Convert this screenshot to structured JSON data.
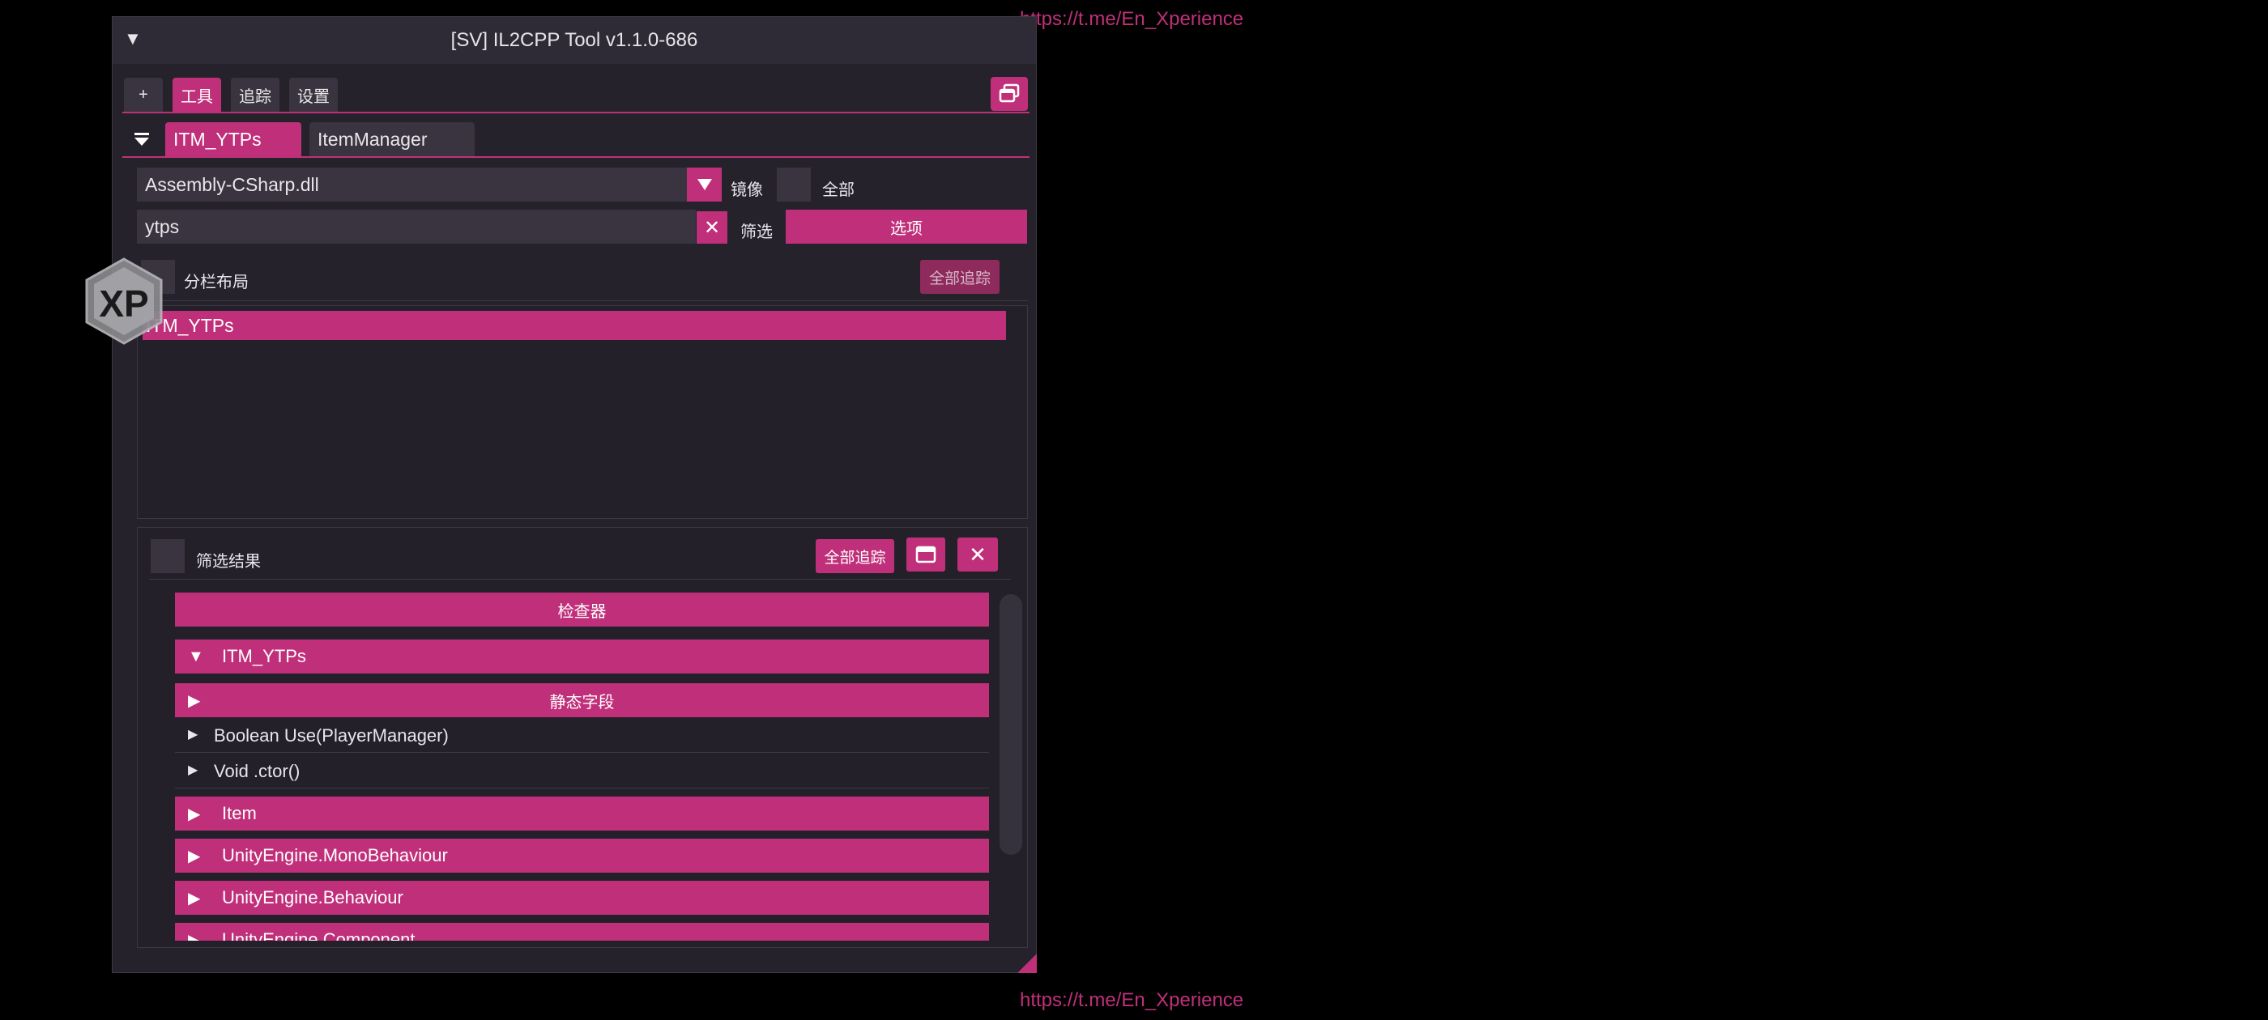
{
  "watermark": {
    "top": "https://t.me/En_Xperience",
    "bottom": "https://t.me/En_Xperience"
  },
  "window": {
    "title": "[SV] IL2CPP Tool v1.1.0-686",
    "collapse_icon": "▼"
  },
  "top_tabs": [
    {
      "label": "+"
    },
    {
      "label": "工具",
      "active": true
    },
    {
      "label": "追踪"
    },
    {
      "label": "设置"
    }
  ],
  "sub_tabs": [
    {
      "label": "ITM_YTPs",
      "active": true
    },
    {
      "label": "ItemManager"
    }
  ],
  "assembly": {
    "value": "Assembly-CSharp.dll",
    "mirror_label": "镜像",
    "all_label": "全部"
  },
  "filter": {
    "value": "ytps",
    "clear_icon": "✕",
    "filter_label": "筛选",
    "options_label": "选项"
  },
  "split_layout": {
    "label": "分栏布局",
    "trace_all_label": "全部追踪"
  },
  "class_list": [
    "ITM_YTPs"
  ],
  "results": {
    "label": "筛选结果",
    "trace_all_label": "全部追踪",
    "inspector_label": "检查器",
    "tree": [
      {
        "kind": "class",
        "expanded": true,
        "label": "ITM_YTPs"
      },
      {
        "kind": "section",
        "expanded": false,
        "label": "静态字段"
      },
      {
        "kind": "method",
        "label": "Boolean Use(PlayerManager)"
      },
      {
        "kind": "method",
        "label": "Void .ctor()"
      },
      {
        "kind": "class",
        "expanded": false,
        "label": "Item"
      },
      {
        "kind": "class",
        "expanded": false,
        "label": "UnityEngine.MonoBehaviour"
      },
      {
        "kind": "class",
        "expanded": false,
        "label": "UnityEngine.Behaviour"
      },
      {
        "kind": "class",
        "expanded": false,
        "label": "UnityEngine.Component"
      }
    ]
  },
  "logo": {
    "text": "XP"
  },
  "colors": {
    "accent": "#c0307a",
    "window_bg": "#25222c",
    "field_bg": "#39343f"
  }
}
